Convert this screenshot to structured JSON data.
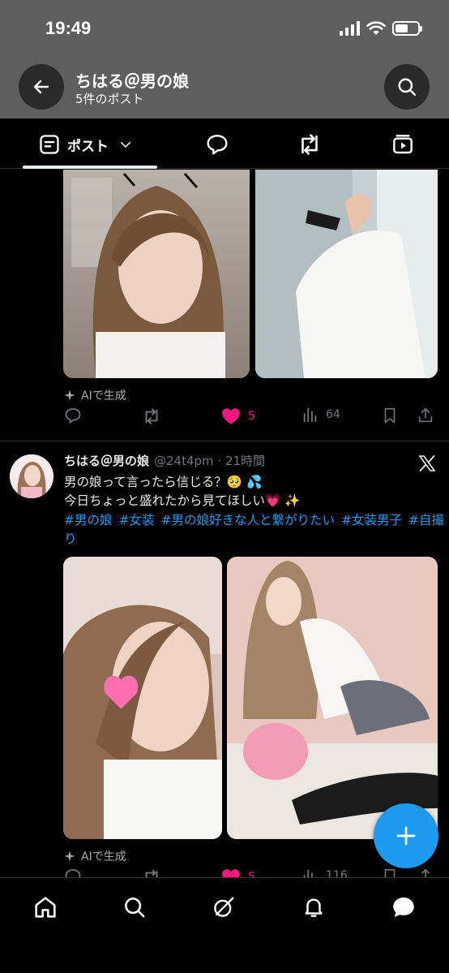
{
  "status": {
    "time": "19:49"
  },
  "header": {
    "name": "ちはる＠男の娘",
    "subtitle": "5件のポスト"
  },
  "tabs": [
    {
      "label": "ポスト",
      "icon": "post-icon",
      "selected": true
    },
    {
      "icon": "reply-icon"
    },
    {
      "icon": "repost-icon"
    },
    {
      "icon": "media-icon"
    }
  ],
  "post1": {
    "ai_label": "AIで生成",
    "likes": "5",
    "views": "64"
  },
  "post2": {
    "name": "ちはる＠男の娘",
    "handle_time": "@24t4pm · 21時間",
    "line1": "男の娘って言ったら信じる？🥺 💦",
    "line2": "今日ちょっと盛れたから見てほしい💗 ✨",
    "hashtags": [
      "#男の娘",
      "#女装",
      "#男の娘好きな人と繋がりたい",
      "#女装男子",
      "#自撮り"
    ],
    "ai_label": "AIで生成",
    "likes": "5",
    "views": "116"
  },
  "colors": {
    "accent": "#1d9bf0",
    "like": "#f91880",
    "muted": "#71767b"
  }
}
